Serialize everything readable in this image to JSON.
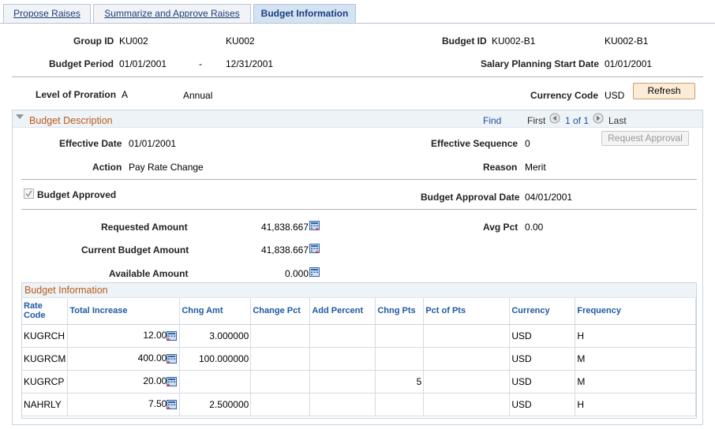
{
  "tabs": [
    {
      "label": "Propose Raises",
      "active": false
    },
    {
      "label": "Summarize and Approve Raises",
      "active": false
    },
    {
      "label": "Budget Information",
      "active": true
    }
  ],
  "header": {
    "group_id_label": "Group ID",
    "group_id_value": "KU002",
    "group_id_desc": "KU002",
    "budget_id_label": "Budget ID",
    "budget_id_value": "KU002-B1",
    "budget_id_desc": "KU002-B1",
    "budget_period_label": "Budget Period",
    "budget_period_start": "01/01/2001",
    "budget_period_sep": "-",
    "budget_period_end": "12/31/2001",
    "salary_start_label": "Salary Planning Start Date",
    "salary_start_value": "01/01/2001",
    "proration_label": "Level of Proration",
    "proration_code": "A",
    "proration_desc": "Annual",
    "currency_label": "Currency Code",
    "currency_value": "USD",
    "refresh_label": "Refresh"
  },
  "budget_description": {
    "title": "Budget Description",
    "find_label": "Find",
    "first_label": "First",
    "page_label": "1 of 1",
    "last_label": "Last",
    "effective_date_label": "Effective Date",
    "effective_date_value": "01/01/2001",
    "effective_seq_label": "Effective Sequence",
    "effective_seq_value": "0",
    "request_approval_label": "Request Approval",
    "action_label": "Action",
    "action_value": "Pay Rate Change",
    "reason_label": "Reason",
    "reason_value": "Merit",
    "approved_label": "Budget Approved",
    "approved_checked": true,
    "approval_date_label": "Budget Approval Date",
    "approval_date_value": "04/01/2001",
    "requested_label": "Requested Amount",
    "requested_value": "41,838.667",
    "avg_pct_label": "Avg Pct",
    "avg_pct_value": "0.00",
    "current_label": "Current Budget Amount",
    "current_value": "41,838.667",
    "available_label": "Available Amount",
    "available_value": "0.000"
  },
  "budget_grid": {
    "title": "Budget Information",
    "columns": [
      "Rate Code",
      "Total Increase",
      "Chng Amt",
      "Change Pct",
      "Add Percent",
      "Chng Pts",
      "Pct of Pts",
      "Currency",
      "Frequency"
    ],
    "rows": [
      {
        "rate_code": "KUGRCH",
        "total_increase": "12.00",
        "chng_amt": "3.000000",
        "change_pct": "",
        "add_percent": "",
        "chng_pts": "",
        "pct_of_pts": "",
        "currency": "USD",
        "frequency": "H"
      },
      {
        "rate_code": "KUGRCM",
        "total_increase": "400.00",
        "chng_amt": "100.000000",
        "change_pct": "",
        "add_percent": "",
        "chng_pts": "",
        "pct_of_pts": "",
        "currency": "USD",
        "frequency": "M"
      },
      {
        "rate_code": "KUGRCP",
        "total_increase": "20.00",
        "chng_amt": "",
        "change_pct": "",
        "add_percent": "",
        "chng_pts": "5",
        "pct_of_pts": "",
        "currency": "USD",
        "frequency": "M"
      },
      {
        "rate_code": "NAHRLY",
        "total_increase": "7.50",
        "chng_amt": "2.500000",
        "change_pct": "",
        "add_percent": "",
        "chng_pts": "",
        "pct_of_pts": "",
        "currency": "USD",
        "frequency": "H"
      }
    ]
  }
}
